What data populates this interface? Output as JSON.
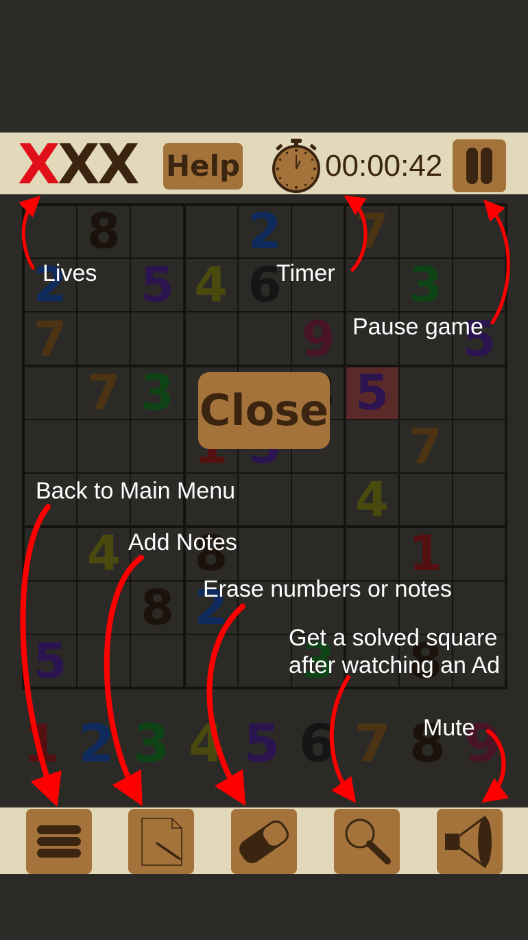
{
  "header": {
    "lives": [
      {
        "symbol": "X",
        "color": "#e0101a"
      },
      {
        "symbol": "X",
        "color": "#3b2410"
      },
      {
        "symbol": "X",
        "color": "#3b2410"
      }
    ],
    "help_label": "Help",
    "timer": "00:00:42",
    "stopwatch_icon": "stopwatch-icon",
    "pause_icon": "pause-icon"
  },
  "board": {
    "cells": [
      {
        "r": 0,
        "c": 1,
        "v": "8",
        "color": "#1a120b"
      },
      {
        "r": 0,
        "c": 4,
        "v": "2",
        "color": "#0f2a5c"
      },
      {
        "r": 0,
        "c": 6,
        "v": "7",
        "color": "#4b3313"
      },
      {
        "r": 1,
        "c": 0,
        "v": "2",
        "color": "#0f2a5c"
      },
      {
        "r": 1,
        "c": 2,
        "v": "5",
        "color": "#2b1450"
      },
      {
        "r": 1,
        "c": 3,
        "v": "4",
        "color": "#4a4a0f"
      },
      {
        "r": 1,
        "c": 4,
        "v": "6",
        "color": "#151515"
      },
      {
        "r": 1,
        "c": 7,
        "v": "3",
        "color": "#0f4416"
      },
      {
        "r": 2,
        "c": 0,
        "v": "7",
        "color": "#4b3313"
      },
      {
        "r": 2,
        "c": 5,
        "v": "9",
        "color": "#4a1428"
      },
      {
        "r": 2,
        "c": 8,
        "v": "5",
        "color": "#2b1450"
      },
      {
        "r": 3,
        "c": 1,
        "v": "7",
        "color": "#4b3313"
      },
      {
        "r": 3,
        "c": 2,
        "v": "3",
        "color": "#0f4416"
      },
      {
        "r": 3,
        "c": 5,
        "v": "8",
        "color": "#1a120b"
      },
      {
        "r": 3,
        "c": 6,
        "v": "5",
        "color": "#2b1450",
        "highlight": "#5a2a2a"
      },
      {
        "r": 4,
        "c": 3,
        "v": "1",
        "color": "#541010"
      },
      {
        "r": 4,
        "c": 4,
        "v": "5",
        "color": "#2b1450"
      },
      {
        "r": 4,
        "c": 7,
        "v": "7",
        "color": "#4b3313"
      },
      {
        "r": 5,
        "c": 6,
        "v": "4",
        "color": "#4a4a0f"
      },
      {
        "r": 6,
        "c": 1,
        "v": "4",
        "color": "#4a4a0f"
      },
      {
        "r": 6,
        "c": 3,
        "v": "8",
        "color": "#1a120b"
      },
      {
        "r": 6,
        "c": 7,
        "v": "1",
        "color": "#541010"
      },
      {
        "r": 7,
        "c": 2,
        "v": "8",
        "color": "#1a120b"
      },
      {
        "r": 7,
        "c": 3,
        "v": "2",
        "color": "#0f2a5c"
      },
      {
        "r": 8,
        "c": 0,
        "v": "5",
        "color": "#2b1450"
      },
      {
        "r": 8,
        "c": 5,
        "v": "3",
        "color": "#0f4416"
      },
      {
        "r": 8,
        "c": 7,
        "v": "8",
        "color": "#1a120b"
      }
    ]
  },
  "dialog": {
    "close_label": "Close"
  },
  "numpad": {
    "keys": [
      {
        "v": "1",
        "color": "#541010"
      },
      {
        "v": "2",
        "color": "#0f2a5c"
      },
      {
        "v": "3",
        "color": "#0f4416"
      },
      {
        "v": "4",
        "color": "#4a4a0f"
      },
      {
        "v": "5",
        "color": "#2b1450"
      },
      {
        "v": "6",
        "color": "#151515"
      },
      {
        "v": "7",
        "color": "#4b3313"
      },
      {
        "v": "8",
        "color": "#1a120b"
      },
      {
        "v": "9",
        "color": "#4a1428"
      }
    ]
  },
  "toolbar": {
    "buttons": [
      {
        "name": "menu-button",
        "icon": "hamburger-menu-icon"
      },
      {
        "name": "notes-button",
        "icon": "pencil-note-icon"
      },
      {
        "name": "erase-button",
        "icon": "eraser-icon"
      },
      {
        "name": "hint-button",
        "icon": "magnifier-icon"
      },
      {
        "name": "mute-button",
        "icon": "speaker-icon"
      }
    ]
  },
  "tutorial": {
    "lives": "Lives",
    "timer": "Timer",
    "pause": "Pause game",
    "menu": "Back to Main Menu",
    "notes": "Add Notes",
    "erase": "Erase numbers or notes",
    "hint_line1": "Get a solved square",
    "hint_line2": "after watching an Ad",
    "mute": "Mute"
  },
  "colors": {
    "background": "#2c2a27",
    "bar": "#e2d9bb",
    "button": "#a3733b",
    "button_text": "#3b2410",
    "arrow": "#ff0000"
  }
}
